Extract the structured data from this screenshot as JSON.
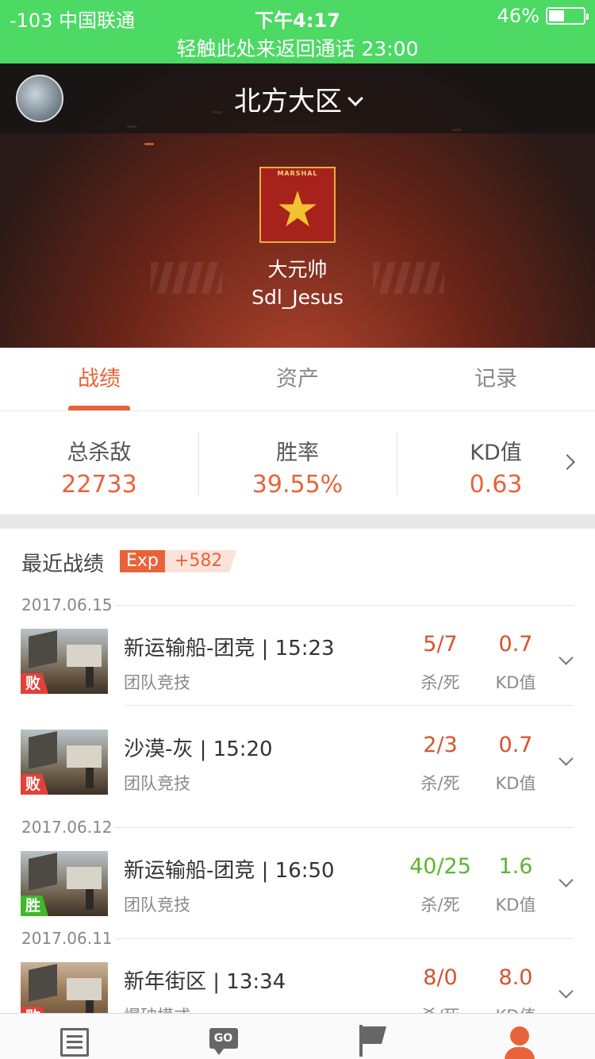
{
  "status_bar": {
    "carrier": "-103 中国联通",
    "time": "下午4:17",
    "battery": "46%",
    "battery_level": 0.46,
    "call_banner": "轻触此处来返回通话 23:00"
  },
  "header": {
    "region": "北方大区",
    "rank_badge_text": "MARSHAL",
    "rank_name": "大元帅",
    "player_name": "Sdl_Jesus"
  },
  "tabs": [
    {
      "label": "战绩",
      "active": true
    },
    {
      "label": "资产",
      "active": false
    },
    {
      "label": "记录",
      "active": false
    }
  ],
  "stats": [
    {
      "label": "总杀敌",
      "value": "22733"
    },
    {
      "label": "胜率",
      "value": "39.55%"
    },
    {
      "label": "KD值",
      "value": "0.63"
    }
  ],
  "recent": {
    "title": "最近战绩",
    "exp_label": "Exp",
    "exp_value": "+582"
  },
  "dates": [
    "2017.06.15",
    "2017.06.12",
    "2017.06.11"
  ],
  "matches": [
    {
      "title": "新运输船-团竞 | 15:23",
      "mode": "团队竞技",
      "kd": "5/7",
      "kd_label": "杀/死",
      "ratio": "0.7",
      "ratio_label": "KD值",
      "result": "败",
      "outcome": "lose"
    },
    {
      "title": "沙漠-灰 | 15:20",
      "mode": "团队竞技",
      "kd": "2/3",
      "kd_label": "杀/死",
      "ratio": "0.7",
      "ratio_label": "KD值",
      "result": "败",
      "outcome": "lose"
    },
    {
      "title": "新运输船-团竞 | 16:50",
      "mode": "团队竞技",
      "kd": "40/25",
      "kd_label": "杀/死",
      "ratio": "1.6",
      "ratio_label": "KD值",
      "result": "胜",
      "outcome": "win"
    },
    {
      "title": "新年街区 | 13:34",
      "mode": "爆破模式",
      "kd": "8/0",
      "kd_label": "杀/死",
      "ratio": "8.0",
      "ratio_label": "KD值",
      "result": "败",
      "outcome": "lose"
    }
  ],
  "bottom_nav": [
    {
      "icon": "news-icon",
      "active": false
    },
    {
      "icon": "go-chat-icon",
      "active": false
    },
    {
      "icon": "flag-icon",
      "active": false
    },
    {
      "icon": "user-icon",
      "active": true
    }
  ],
  "colors": {
    "accent": "#e9633a",
    "status_bar": "#4cd964",
    "lose": "#e2413a",
    "win": "#3fb82b"
  }
}
